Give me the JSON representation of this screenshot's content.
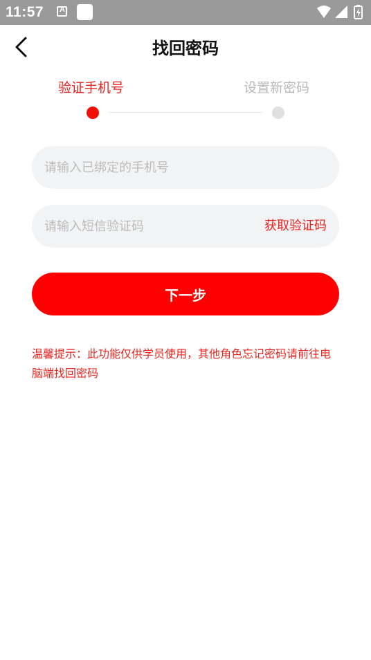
{
  "status_bar": {
    "time": "11:57",
    "icons": [
      "notification-a-icon",
      "notification-square-icon",
      "wifi-icon",
      "cellular-signal-icon",
      "battery-charging-icon"
    ]
  },
  "header": {
    "title": "找回密码",
    "back_icon": "back-arrow-icon"
  },
  "steps": {
    "current": 1,
    "items": [
      {
        "label": "验证手机号",
        "state": "active"
      },
      {
        "label": "设置新密码",
        "state": "inactive"
      }
    ]
  },
  "form": {
    "phone": {
      "placeholder": "请输入已绑定的手机号",
      "value": ""
    },
    "code": {
      "placeholder": "请输入短信验证码",
      "value": ""
    },
    "get_code_label": "获取验证码",
    "next_label": "下一步"
  },
  "tip": "温馨提示：此功能仅供学员使用，其他角色忘记密码请前往电脑端找回密码",
  "colors": {
    "accent": "#e8231e",
    "button": "#ff0000",
    "status_bar": "#9a9a9a",
    "input_bg": "#f2f3f5",
    "inactive": "#b9b9b9"
  }
}
